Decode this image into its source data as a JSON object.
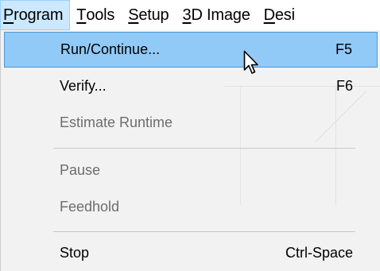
{
  "menubar": {
    "items": [
      {
        "label": "Program",
        "mnemonic": "P"
      },
      {
        "label": "Tools",
        "mnemonic": "T"
      },
      {
        "label": "Setup",
        "mnemonic": "S"
      },
      {
        "label": "3D Image",
        "mnemonic": "3"
      },
      {
        "label": "Desi",
        "mnemonic": "D"
      }
    ],
    "active_index": 0
  },
  "program_menu": {
    "items": [
      {
        "label": "Run/Continue...",
        "shortcut": "F5",
        "enabled": true,
        "highlighted": true
      },
      {
        "label": "Verify...",
        "shortcut": "F6",
        "enabled": true,
        "highlighted": false
      },
      {
        "label": "Estimate Runtime",
        "shortcut": "",
        "enabled": false,
        "highlighted": false
      },
      {
        "label": "Pause",
        "shortcut": "",
        "enabled": false,
        "highlighted": false
      },
      {
        "label": "Feedhold",
        "shortcut": "",
        "enabled": false,
        "highlighted": false
      },
      {
        "label": "Stop",
        "shortcut": "Ctrl-Space",
        "enabled": true,
        "highlighted": false
      }
    ],
    "separators_after": [
      2,
      4
    ]
  },
  "cursor": {
    "icon": "arrow-pointer-icon"
  },
  "colors": {
    "menubar_bg": "#ffffff",
    "menubar_active_bg": "#cce8ff",
    "menu_bg": "#f2f2f2",
    "highlight_bg": "#91c9f7",
    "highlight_border": "#4c99d8",
    "disabled_text": "#6d6d6d"
  }
}
